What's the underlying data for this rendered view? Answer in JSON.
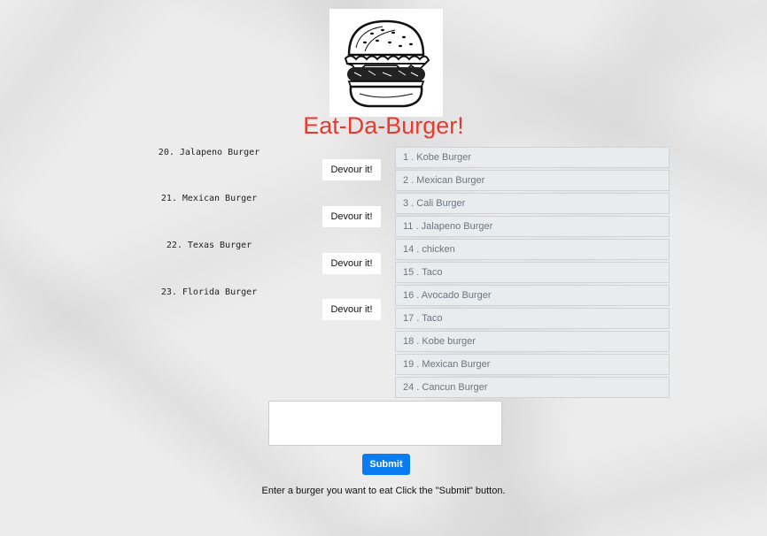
{
  "header": {
    "title": "Eat-Da-Burger!",
    "logo_icon": "burger-drawing-icon"
  },
  "pending_burgers": [
    {
      "name": "20. Jalapeno Burger",
      "button_label": "Devour it!"
    },
    {
      "name": "21. Mexican Burger",
      "button_label": "Devour it!"
    },
    {
      "name": "22. Texas Burger",
      "button_label": "Devour it!"
    },
    {
      "name": "23. Florida Burger",
      "button_label": "Devour it!"
    }
  ],
  "devoured_burgers": [
    "1 . Kobe Burger",
    "2 . Mexican Burger",
    "3 . Cali Burger",
    "11 . Jalapeno Burger",
    "14 . chicken",
    "15 . Taco",
    "16 . Avocado Burger",
    "17 . Taco",
    "18 . Kobe burger",
    "19 . Mexican Burger",
    "24 . Cancun Burger"
  ],
  "form": {
    "input_value": "",
    "submit_label": "Submit",
    "instructions": "Enter a burger you want to eat Click the \"Submit\" button."
  },
  "colors": {
    "title": "#e8392f",
    "submit_button": "#0a7cf2",
    "list_item_bg": "#e9ecef",
    "list_item_text": "#6c757d"
  }
}
